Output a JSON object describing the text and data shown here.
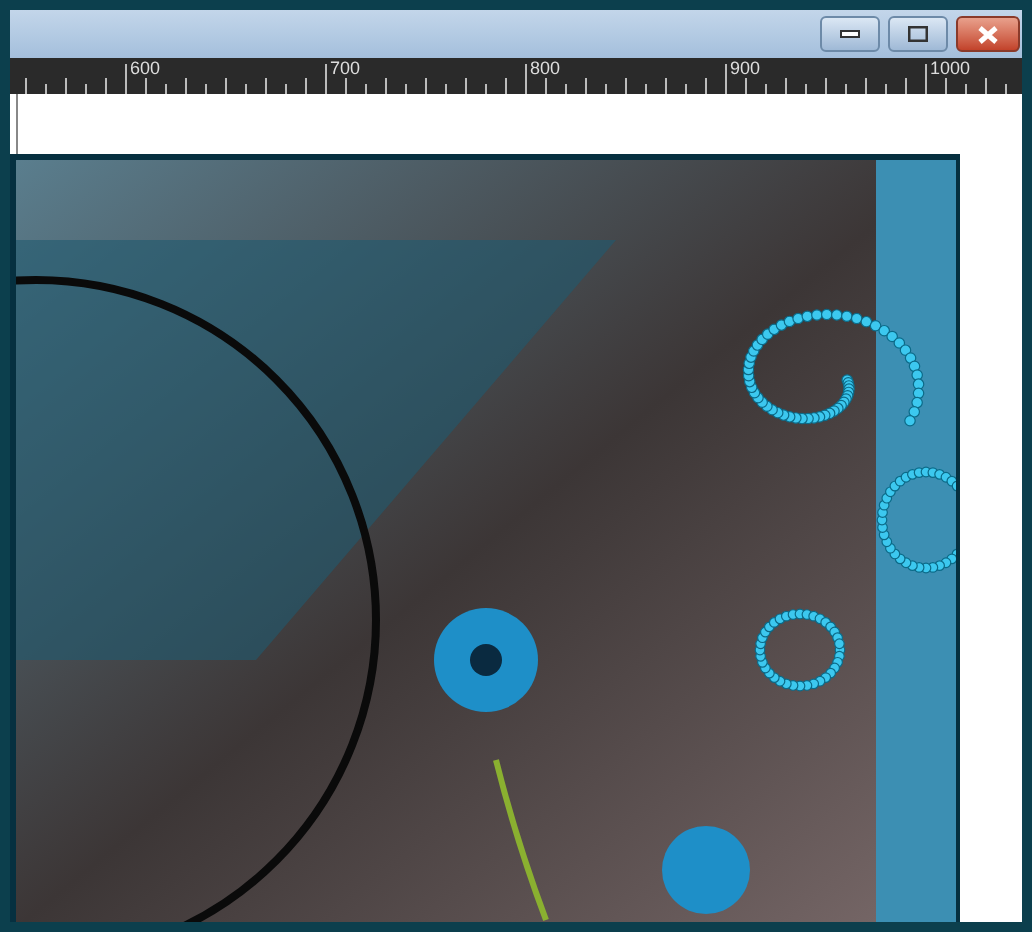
{
  "window": {
    "buttons": [
      {
        "kind": "minimize"
      },
      {
        "kind": "maximize"
      },
      {
        "kind": "close"
      }
    ]
  },
  "ruler": {
    "labels": [
      "600",
      "700",
      "800",
      "900",
      "1000"
    ]
  }
}
